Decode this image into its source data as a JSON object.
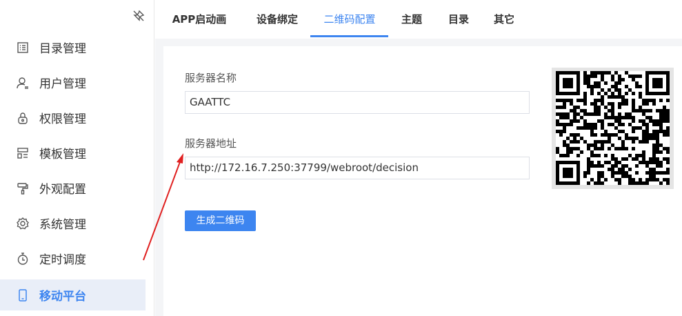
{
  "sidebar": {
    "items": [
      {
        "label": "目录管理",
        "icon": "list-icon"
      },
      {
        "label": "用户管理",
        "icon": "user-icon"
      },
      {
        "label": "权限管理",
        "icon": "lock-icon"
      },
      {
        "label": "模板管理",
        "icon": "template-icon"
      },
      {
        "label": "外观配置",
        "icon": "paint-roller-icon"
      },
      {
        "label": "系统管理",
        "icon": "gear-icon"
      },
      {
        "label": "定时调度",
        "icon": "stopwatch-icon"
      },
      {
        "label": "移动平台",
        "icon": "mobile-icon"
      }
    ],
    "active_index": 7
  },
  "tabs": [
    {
      "label": "APP启动画面"
    },
    {
      "label": "设备绑定"
    },
    {
      "label": "二维码配置"
    },
    {
      "label": "主题"
    },
    {
      "label": "目录"
    },
    {
      "label": "其它"
    }
  ],
  "active_tab_index": 2,
  "form": {
    "server_name_label": "服务器名称",
    "server_name_value": "GAATTC",
    "server_address_label": "服务器地址",
    "server_address_value": "http://172.16.7.250:37799/webroot/decision",
    "generate_button": "生成二维码"
  },
  "colors": {
    "accent": "#3d85f0",
    "active_bg": "#e9eef8",
    "arrow": "#e02020"
  }
}
